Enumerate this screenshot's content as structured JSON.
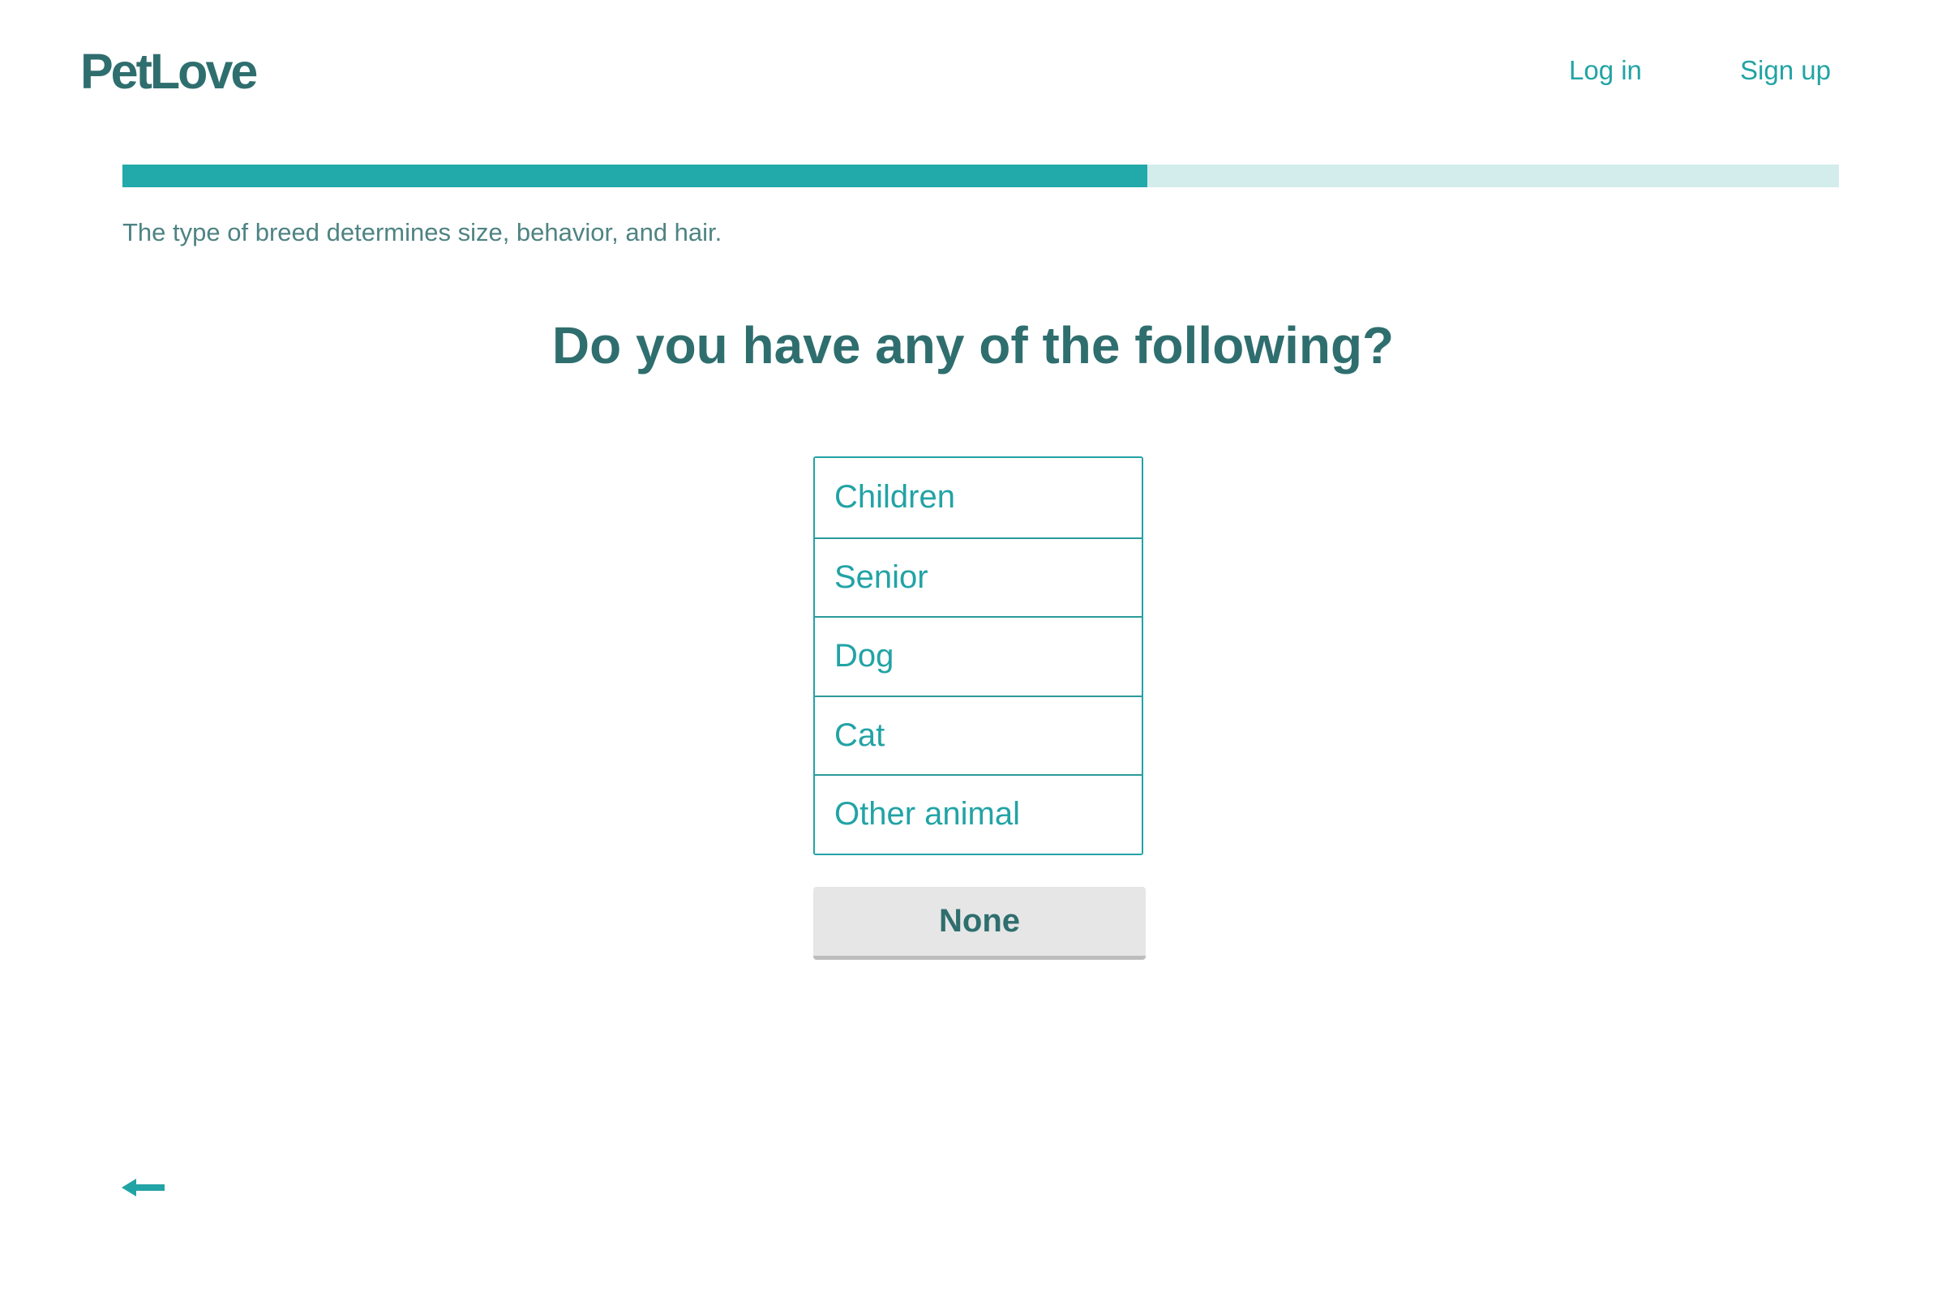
{
  "header": {
    "logo": "PetLove",
    "login_label": "Log in",
    "signup_label": "Sign up"
  },
  "progress": {
    "value": 0.597
  },
  "hint": "The type of breed determines size, behavior, and hair.",
  "question": "Do you have any of the following?",
  "options": [
    "Children",
    "Senior",
    "Dog",
    "Cat",
    "Other animal"
  ],
  "none_label": "None",
  "icons": {
    "back": "arrow-left-icon"
  },
  "colors": {
    "brand": "#2f6e6e",
    "accent": "#22a3a5",
    "progress_fill": "#22a9a9",
    "progress_track": "#d3ecec",
    "none_bg": "#e6e6e6"
  }
}
